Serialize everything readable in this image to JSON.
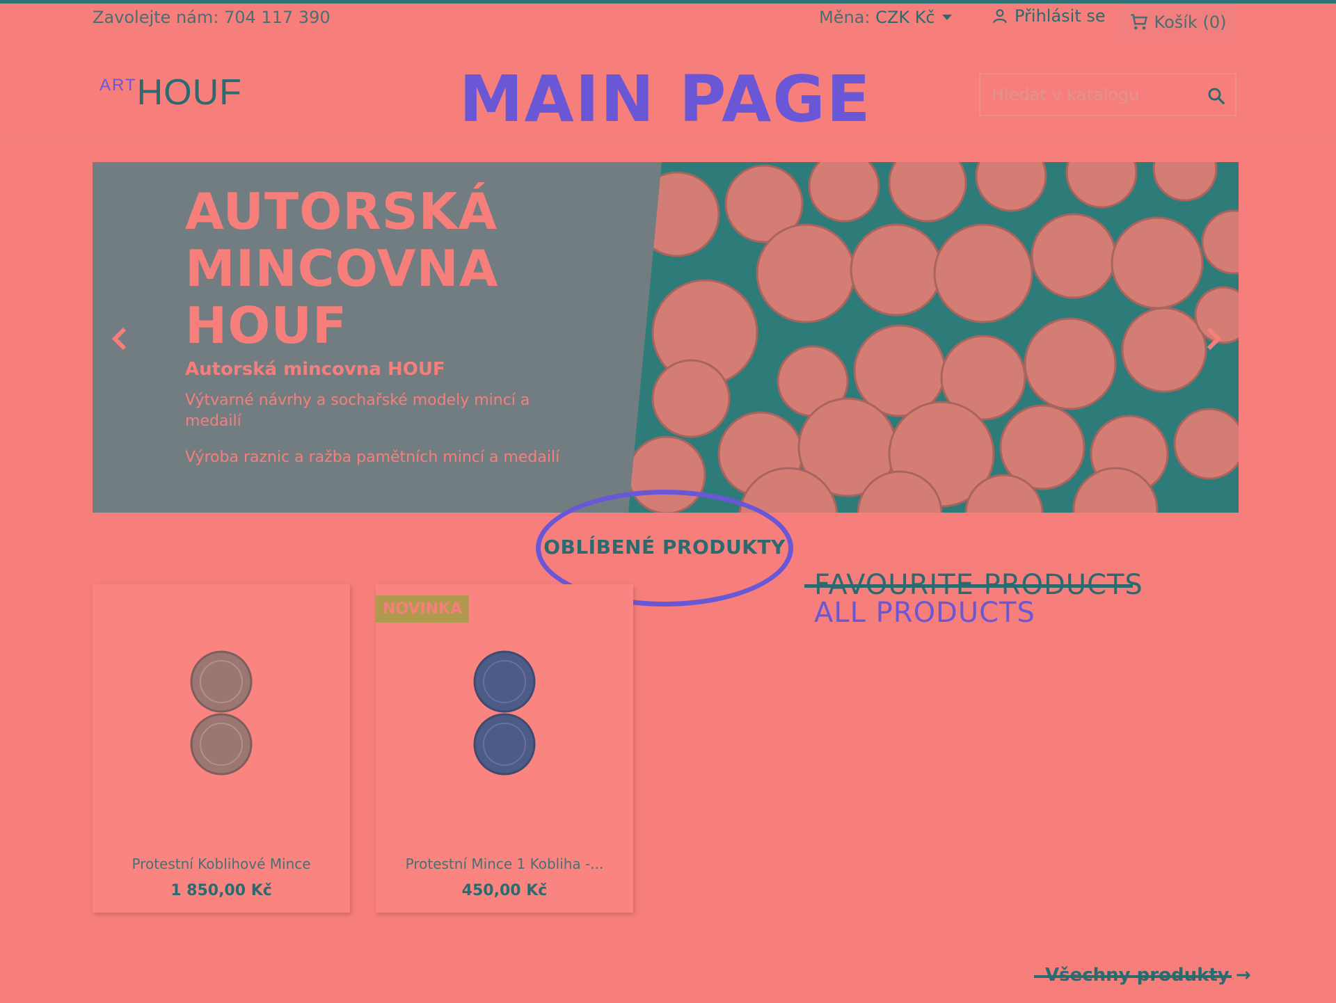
{
  "topbar": {
    "contact": "Zavolejte nám: 704 117 390",
    "currency_label": "Měna:",
    "currency_value": "CZK Kč",
    "login": "Přihlásit se",
    "cart": "Košík (0)"
  },
  "header": {
    "logo_art": "ART",
    "logo_houf": "HOUF",
    "annotation_title": "MAIN PAGE",
    "search_placeholder": "Hledat v katalogu"
  },
  "hero": {
    "title_line1": "AUTORSKÁ",
    "title_line2": "MINCOVNA",
    "title_line3": "HOUF",
    "subtitle": "Autorská mincovna HOUF",
    "text1": "Výtvarné návrhy a sochařské modely mincí a medailí",
    "text2": "Výroba raznic a ražba pamětních mincí a medailí"
  },
  "section": {
    "title": "OBLÍBENÉ PRODUKTY",
    "annotation_struck": "FAVOURITE PRODUCTS",
    "annotation_new": "ALL PRODUCTS"
  },
  "products": [
    {
      "name": "Protestní Koblihové Mince",
      "price": "1 850,00 Kč",
      "badge": ""
    },
    {
      "name": "Protestní Mince 1 Kobliha -...",
      "price": "450,00 Kč",
      "badge": "NOVINKA"
    }
  ],
  "all_products_link": "Všechny produkty",
  "colors": {
    "background": "#f67f7b",
    "teal": "#2b6b70",
    "annotation_purple": "#6a57d6",
    "badge": "#b09a4e"
  }
}
